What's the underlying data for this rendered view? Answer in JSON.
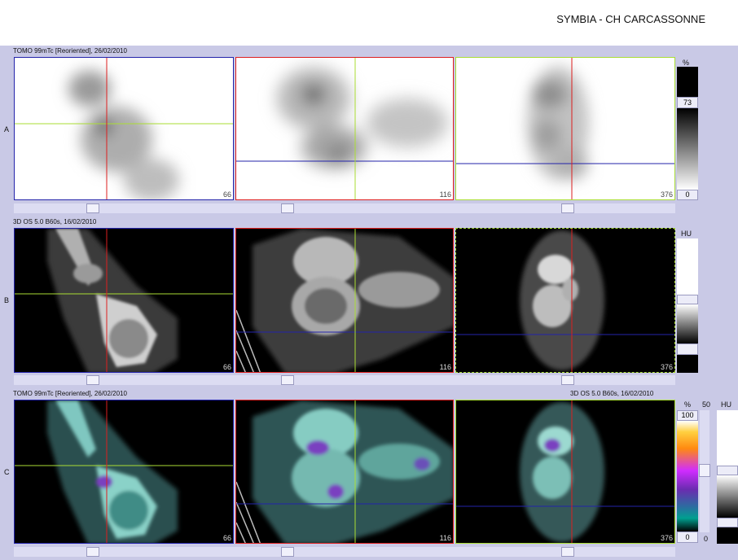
{
  "header": {
    "title": "SYMBIA - CH CARCASSONNE"
  },
  "rows": [
    {
      "letter": "A",
      "label": "TOMO 99mTc [Reoriented], 26/02/2010",
      "slices": [
        "66",
        "116",
        "376"
      ]
    },
    {
      "letter": "B",
      "label": "3D  OS  5.0  B60s, 16/02/2010",
      "slices": [
        "66",
        "116",
        "376"
      ]
    },
    {
      "letter": "C",
      "label": "TOMO 99mTc [Reoriented], 26/02/2010",
      "label_right": "3D  OS  5.0  B60s, 16/02/2010",
      "slices": [
        "66",
        "116",
        "376"
      ]
    }
  ],
  "colorbars": {
    "a": {
      "unit": "%",
      "level": "73",
      "min": "0"
    },
    "b": {
      "unit": "HU"
    },
    "c": {
      "unit": "%",
      "max": "100",
      "min": "0",
      "mid_label": "50",
      "zero_label": "0",
      "unit2": "HU"
    }
  },
  "colors": {
    "background": "#c9c9e6",
    "sagittal": "#dd1f1f",
    "coronal": "#aadd33",
    "transverse": "#2323aa"
  },
  "icons": [
    "crosshair-icon",
    "scroll-thumb"
  ]
}
